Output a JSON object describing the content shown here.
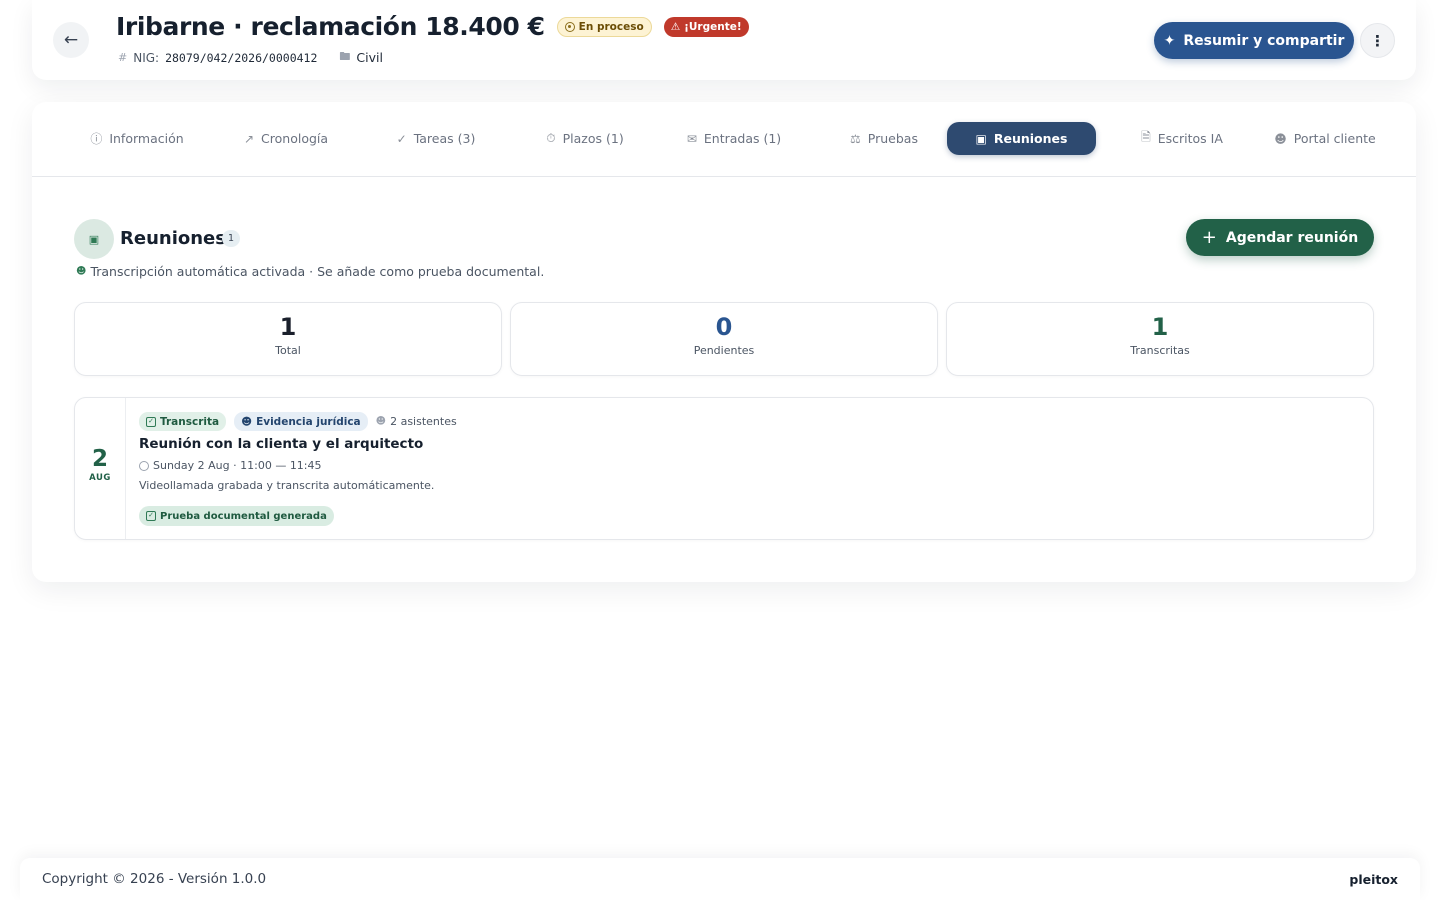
{
  "header": {
    "title": "Iribarne · reclamación 18.400 €",
    "status_badge": "En proceso",
    "urgent_badge": "¡Urgente!",
    "nig_label": "NIG:",
    "nig_value": "28079/042/2026/0000412",
    "jurisdiction": "Civil",
    "summarize_button": "Resumir y compartir",
    "colors": {
      "primary": "#2a5590",
      "urgent": "#c0392b"
    }
  },
  "tabs": [
    {
      "label": "Información",
      "icon": "info-icon"
    },
    {
      "label": "Cronología",
      "icon": "trend-icon"
    },
    {
      "label": "Tareas (3)",
      "icon": "check-circle-icon"
    },
    {
      "label": "Plazos (1)",
      "icon": "stopwatch-icon"
    },
    {
      "label": "Entradas (1)",
      "icon": "mail-icon"
    },
    {
      "label": "Pruebas",
      "icon": "gavel-icon"
    },
    {
      "label": "Reuniones",
      "icon": "video-icon",
      "active": true
    },
    {
      "label": "Escritos IA",
      "icon": "document-icon"
    },
    {
      "label": "Portal cliente",
      "icon": "users-icon"
    }
  ],
  "section": {
    "title": "Reuniones",
    "count": "1",
    "subtitle": "Transcripción automática activada · Se añade como prueba documental.",
    "add_button": "Agendar reunión",
    "accent": "#226148"
  },
  "stats": [
    {
      "value": "1",
      "label": "Total"
    },
    {
      "value": "0",
      "label": "Pendientes"
    },
    {
      "value": "1",
      "label": "Transcritas"
    }
  ],
  "meeting": {
    "day": "2",
    "month": "AUG",
    "tag_transcribed": "Transcrita",
    "tag_evidence": "Evidencia jurídica",
    "attendees": "2 asistentes",
    "title": "Reunión con la clienta y el arquitecto",
    "time": "Sunday 2 Aug · 11:00 — 11:45",
    "description": "Videollamada grabada y transcrita automáticamente.",
    "proof_tag": "Prueba documental generada"
  },
  "footer": {
    "copyright": "Copyright © 2026 - Versión 1.0.0",
    "brand": "pleitox"
  }
}
